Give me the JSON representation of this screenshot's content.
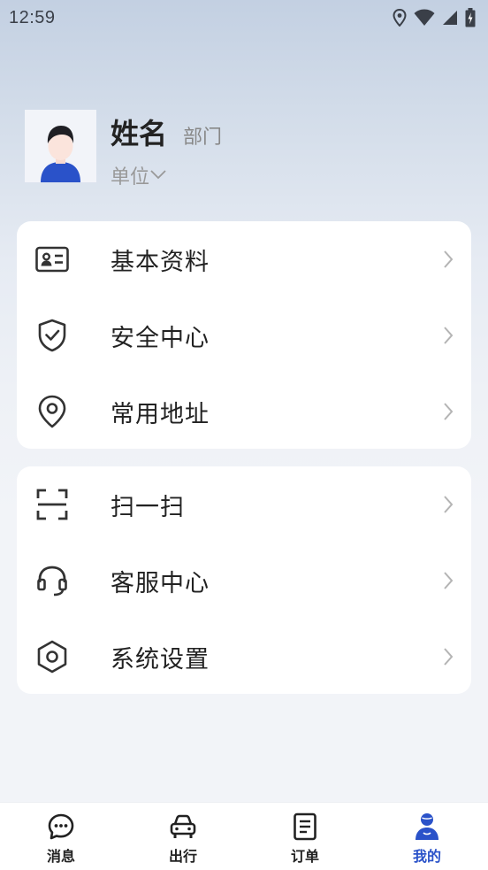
{
  "status_bar": {
    "time": "12:59"
  },
  "profile": {
    "name": "姓名",
    "department": "部门",
    "unit": "单位"
  },
  "menu_group_1": [
    {
      "label": "基本资料",
      "icon": "id-card-icon"
    },
    {
      "label": "安全中心",
      "icon": "shield-check-icon"
    },
    {
      "label": "常用地址",
      "icon": "location-pin-icon"
    }
  ],
  "menu_group_2": [
    {
      "label": "扫一扫",
      "icon": "scan-icon"
    },
    {
      "label": "客服中心",
      "icon": "headset-icon"
    },
    {
      "label": "系统设置",
      "icon": "settings-hexagon-icon"
    }
  ],
  "tab_bar": {
    "tabs": [
      {
        "label": "消息",
        "icon": "chat-bubble-icon"
      },
      {
        "label": "出行",
        "icon": "car-icon"
      },
      {
        "label": "订单",
        "icon": "order-list-icon"
      },
      {
        "label": "我的",
        "icon": "user-icon"
      }
    ],
    "active_index": 3
  },
  "colors": {
    "accent": "#2a52c9",
    "text": "#222222",
    "muted": "#888888",
    "icon": "#333333",
    "chevron": "#b4b4b4"
  }
}
